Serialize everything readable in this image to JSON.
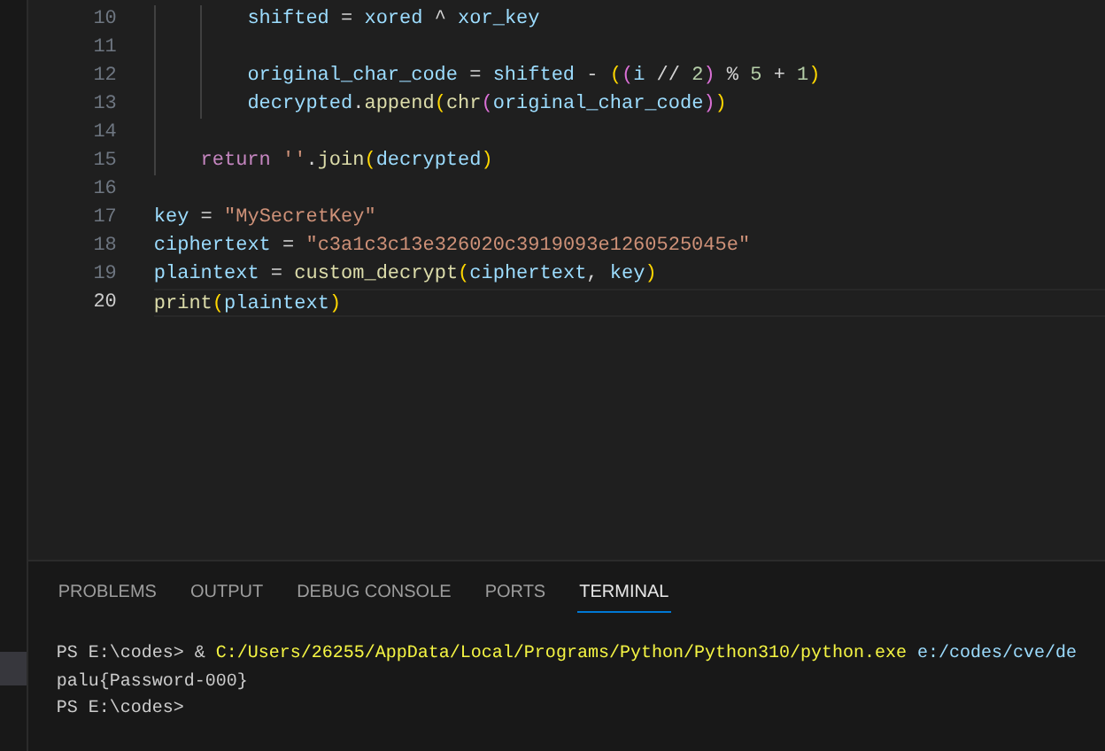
{
  "editor": {
    "lines": [
      {
        "number": "10",
        "current": false,
        "tokens": [
          {
            "text": "shifted",
            "kind": "var"
          },
          {
            "text": " = ",
            "kind": "op"
          },
          {
            "text": "xored",
            "kind": "var"
          },
          {
            "text": " ^ ",
            "kind": "op"
          },
          {
            "text": "xor_key",
            "kind": "var"
          }
        ]
      },
      {
        "number": "11",
        "current": false
      },
      {
        "number": "12",
        "current": false,
        "tokens": [
          {
            "text": "original_char_code",
            "kind": "var"
          },
          {
            "text": " = ",
            "kind": "op"
          },
          {
            "text": "shifted",
            "kind": "var"
          },
          {
            "text": " - ",
            "kind": "op"
          },
          {
            "text": "(",
            "kind": "b1"
          },
          {
            "text": "(",
            "kind": "b2"
          },
          {
            "text": "i",
            "kind": "var"
          },
          {
            "text": " // ",
            "kind": "op"
          },
          {
            "text": "2",
            "kind": "number"
          },
          {
            "text": ")",
            "kind": "b2"
          },
          {
            "text": " % ",
            "kind": "op"
          },
          {
            "text": "5",
            "kind": "number"
          },
          {
            "text": " + ",
            "kind": "op"
          },
          {
            "text": "1",
            "kind": "number"
          },
          {
            "text": ")",
            "kind": "b1"
          }
        ]
      },
      {
        "number": "13",
        "current": false,
        "tokens": [
          {
            "text": "decrypted",
            "kind": "var"
          },
          {
            "text": ".",
            "kind": "op"
          },
          {
            "text": "append",
            "kind": "func"
          },
          {
            "text": "(",
            "kind": "b1"
          },
          {
            "text": "chr",
            "kind": "func"
          },
          {
            "text": "(",
            "kind": "b2"
          },
          {
            "text": "original_char_code",
            "kind": "var"
          },
          {
            "text": ")",
            "kind": "b2"
          },
          {
            "text": ")",
            "kind": "b1"
          }
        ]
      },
      {
        "number": "14",
        "current": false
      },
      {
        "number": "15",
        "current": false,
        "tokens": [
          {
            "text": "return ",
            "kind": "keyword"
          },
          {
            "text": "''",
            "kind": "string"
          },
          {
            "text": ".",
            "kind": "op"
          },
          {
            "text": "join",
            "kind": "func"
          },
          {
            "text": "(",
            "kind": "b1"
          },
          {
            "text": "decrypted",
            "kind": "var"
          },
          {
            "text": ")",
            "kind": "b1"
          }
        ]
      },
      {
        "number": "16",
        "current": false
      },
      {
        "number": "17",
        "current": false,
        "tokens": [
          {
            "text": "key",
            "kind": "var"
          },
          {
            "text": " = ",
            "kind": "op"
          },
          {
            "text": "\"MySecretKey\"",
            "kind": "string"
          }
        ]
      },
      {
        "number": "18",
        "current": false,
        "tokens": [
          {
            "text": "ciphertext",
            "kind": "var"
          },
          {
            "text": " = ",
            "kind": "op"
          },
          {
            "text": "\"c3a1c3c13e326020c3919093e1260525045e\"",
            "kind": "string"
          }
        ]
      },
      {
        "number": "19",
        "current": false,
        "tokens": [
          {
            "text": "plaintext",
            "kind": "var"
          },
          {
            "text": " = ",
            "kind": "op"
          },
          {
            "text": "custom_decrypt",
            "kind": "func"
          },
          {
            "text": "(",
            "kind": "b1"
          },
          {
            "text": "ciphertext",
            "kind": "var"
          },
          {
            "text": ", ",
            "kind": "op"
          },
          {
            "text": "key",
            "kind": "var"
          },
          {
            "text": ")",
            "kind": "b1"
          }
        ]
      },
      {
        "number": "20",
        "current": true,
        "tokens": [
          {
            "text": "print",
            "kind": "func"
          },
          {
            "text": "(",
            "kind": "b1"
          },
          {
            "text": "plaintext",
            "kind": "var"
          },
          {
            "text": ")",
            "kind": "b1"
          }
        ]
      }
    ]
  },
  "panel": {
    "tabs": [
      {
        "label": "PROBLEMS",
        "selected": false
      },
      {
        "label": "OUTPUT",
        "selected": false
      },
      {
        "label": "DEBUG CONSOLE",
        "selected": false
      },
      {
        "label": "PORTS",
        "selected": false
      },
      {
        "label": "TERMINAL",
        "selected": true
      }
    ],
    "terminal": [
      {
        "tokens": [
          {
            "text": "PS E:\\codes> & ",
            "kind": "plain"
          },
          {
            "text": "C:/Users/26255/AppData/Local/Programs/Python/Python310/python.exe",
            "kind": "command"
          },
          {
            "text": " e:/codes/cve/de",
            "kind": "argument"
          }
        ]
      },
      {
        "tokens": [
          {
            "text": "palu{Password-000}",
            "kind": "plain"
          }
        ]
      },
      {
        "tokens": [
          {
            "text": "PS E:\\codes>",
            "kind": "plain"
          }
        ]
      }
    ]
  }
}
